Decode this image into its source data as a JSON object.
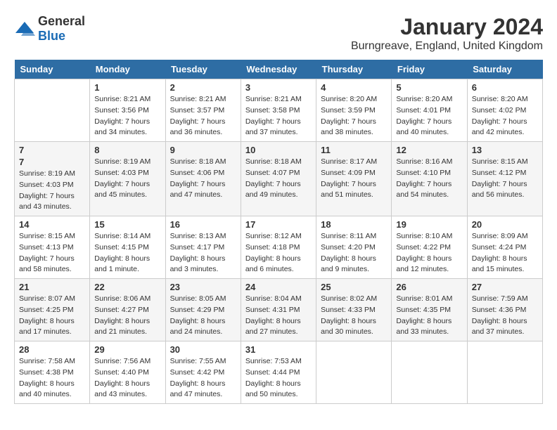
{
  "logo": {
    "general": "General",
    "blue": "Blue"
  },
  "title": "January 2024",
  "location": "Burngreave, England, United Kingdom",
  "days_header": [
    "Sunday",
    "Monday",
    "Tuesday",
    "Wednesday",
    "Thursday",
    "Friday",
    "Saturday"
  ],
  "weeks": [
    [
      {
        "day": "",
        "info": ""
      },
      {
        "day": "1",
        "info": "Sunrise: 8:21 AM\nSunset: 3:56 PM\nDaylight: 7 hours\nand 34 minutes."
      },
      {
        "day": "2",
        "info": "Sunrise: 8:21 AM\nSunset: 3:57 PM\nDaylight: 7 hours\nand 36 minutes."
      },
      {
        "day": "3",
        "info": "Sunrise: 8:21 AM\nSunset: 3:58 PM\nDaylight: 7 hours\nand 37 minutes."
      },
      {
        "day": "4",
        "info": "Sunrise: 8:20 AM\nSunset: 3:59 PM\nDaylight: 7 hours\nand 38 minutes."
      },
      {
        "day": "5",
        "info": "Sunrise: 8:20 AM\nSunset: 4:01 PM\nDaylight: 7 hours\nand 40 minutes."
      },
      {
        "day": "6",
        "info": "Sunrise: 8:20 AM\nSunset: 4:02 PM\nDaylight: 7 hours\nand 42 minutes."
      }
    ],
    [
      {
        "day": "7",
        "info": ""
      },
      {
        "day": "8",
        "info": "Sunrise: 8:19 AM\nSunset: 4:03 PM\nDaylight: 7 hours\nand 45 minutes."
      },
      {
        "day": "9",
        "info": "Sunrise: 8:18 AM\nSunset: 4:06 PM\nDaylight: 7 hours\nand 47 minutes."
      },
      {
        "day": "10",
        "info": "Sunrise: 8:18 AM\nSunset: 4:07 PM\nDaylight: 7 hours\nand 49 minutes."
      },
      {
        "day": "11",
        "info": "Sunrise: 8:17 AM\nSunset: 4:09 PM\nDaylight: 7 hours\nand 51 minutes."
      },
      {
        "day": "12",
        "info": "Sunrise: 8:16 AM\nSunset: 4:10 PM\nDaylight: 7 hours\nand 54 minutes."
      },
      {
        "day": "13",
        "info": "Sunrise: 8:15 AM\nSunset: 4:12 PM\nDaylight: 7 hours\nand 56 minutes."
      }
    ],
    [
      {
        "day": "14",
        "info": "Sunrise: 8:15 AM\nSunset: 4:13 PM\nDaylight: 7 hours\nand 58 minutes."
      },
      {
        "day": "15",
        "info": "Sunrise: 8:14 AM\nSunset: 4:15 PM\nDaylight: 8 hours\nand 1 minute."
      },
      {
        "day": "16",
        "info": "Sunrise: 8:13 AM\nSunset: 4:17 PM\nDaylight: 8 hours\nand 3 minutes."
      },
      {
        "day": "17",
        "info": "Sunrise: 8:12 AM\nSunset: 4:18 PM\nDaylight: 8 hours\nand 6 minutes."
      },
      {
        "day": "18",
        "info": "Sunrise: 8:11 AM\nSunset: 4:20 PM\nDaylight: 8 hours\nand 9 minutes."
      },
      {
        "day": "19",
        "info": "Sunrise: 8:10 AM\nSunset: 4:22 PM\nDaylight: 8 hours\nand 12 minutes."
      },
      {
        "day": "20",
        "info": "Sunrise: 8:09 AM\nSunset: 4:24 PM\nDaylight: 8 hours\nand 15 minutes."
      }
    ],
    [
      {
        "day": "21",
        "info": "Sunrise: 8:07 AM\nSunset: 4:25 PM\nDaylight: 8 hours\nand 17 minutes."
      },
      {
        "day": "22",
        "info": "Sunrise: 8:06 AM\nSunset: 4:27 PM\nDaylight: 8 hours\nand 21 minutes."
      },
      {
        "day": "23",
        "info": "Sunrise: 8:05 AM\nSunset: 4:29 PM\nDaylight: 8 hours\nand 24 minutes."
      },
      {
        "day": "24",
        "info": "Sunrise: 8:04 AM\nSunset: 4:31 PM\nDaylight: 8 hours\nand 27 minutes."
      },
      {
        "day": "25",
        "info": "Sunrise: 8:02 AM\nSunset: 4:33 PM\nDaylight: 8 hours\nand 30 minutes."
      },
      {
        "day": "26",
        "info": "Sunrise: 8:01 AM\nSunset: 4:35 PM\nDaylight: 8 hours\nand 33 minutes."
      },
      {
        "day": "27",
        "info": "Sunrise: 7:59 AM\nSunset: 4:36 PM\nDaylight: 8 hours\nand 37 minutes."
      }
    ],
    [
      {
        "day": "28",
        "info": "Sunrise: 7:58 AM\nSunset: 4:38 PM\nDaylight: 8 hours\nand 40 minutes."
      },
      {
        "day": "29",
        "info": "Sunrise: 7:56 AM\nSunset: 4:40 PM\nDaylight: 8 hours\nand 43 minutes."
      },
      {
        "day": "30",
        "info": "Sunrise: 7:55 AM\nSunset: 4:42 PM\nDaylight: 8 hours\nand 47 minutes."
      },
      {
        "day": "31",
        "info": "Sunrise: 7:53 AM\nSunset: 4:44 PM\nDaylight: 8 hours\nand 50 minutes."
      },
      {
        "day": "",
        "info": ""
      },
      {
        "day": "",
        "info": ""
      },
      {
        "day": "",
        "info": ""
      }
    ]
  ]
}
